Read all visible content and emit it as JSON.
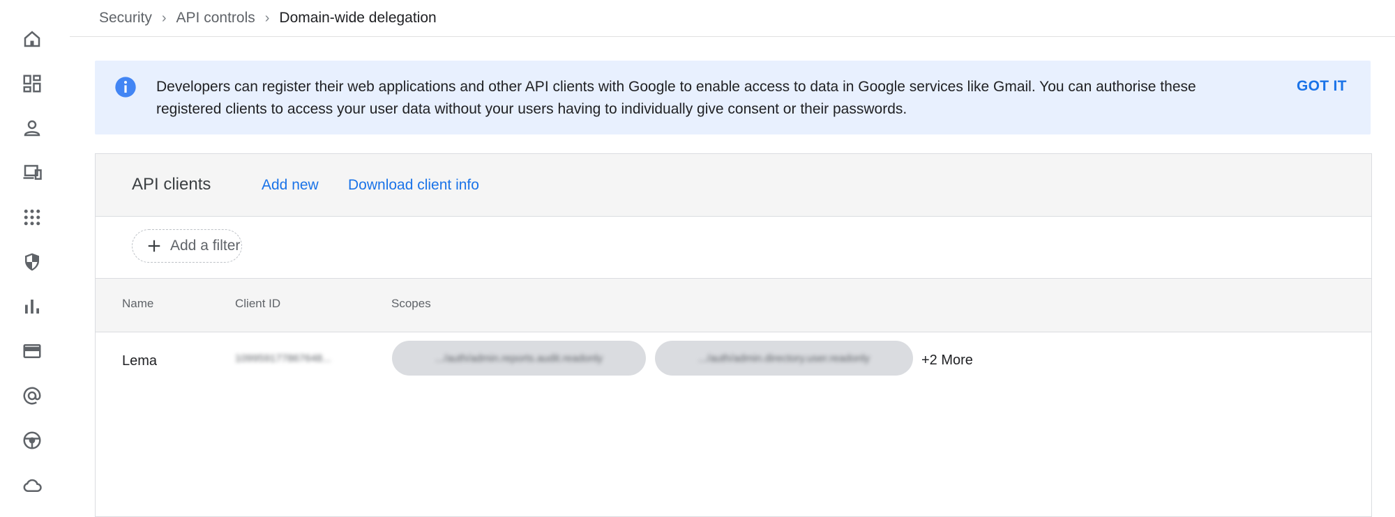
{
  "sidebar": {
    "items": [
      {
        "icon": "home-icon"
      },
      {
        "icon": "dashboard-icon"
      },
      {
        "icon": "user-icon"
      },
      {
        "icon": "devices-icon"
      },
      {
        "icon": "apps-grid-icon"
      },
      {
        "icon": "shield-icon"
      },
      {
        "icon": "reports-chart-icon"
      },
      {
        "icon": "billing-card-icon"
      },
      {
        "icon": "account-at-icon"
      },
      {
        "icon": "rules-wheel-icon"
      },
      {
        "icon": "cloud-icon"
      }
    ]
  },
  "breadcrumb": {
    "items": [
      "Security",
      "API controls"
    ],
    "current": "Domain-wide delegation"
  },
  "banner": {
    "line1": "Developers can register their web applications and other API clients with Google to enable access to data in Google services like Gmail. You can authorise these",
    "line2": "registered clients to access your user data without your users having to individually give consent or their passwords.",
    "action": "GOT IT"
  },
  "api_clients": {
    "title": "API clients",
    "add_new": "Add new",
    "download": "Download client info",
    "filter_label": "Add a filter",
    "columns": [
      "Name",
      "Client ID",
      "Scopes"
    ],
    "rows": [
      {
        "name": "Lema",
        "client_id": "109959177867648...",
        "scopes": [
          ".../auth/admin.reports.audit.readonly",
          ".../auth/admin.directory.user.readonly"
        ],
        "more": "+2 More"
      }
    ]
  },
  "colors": {
    "accent": "#1a73e8",
    "banner_bg": "#e8f0fe",
    "header_bg": "#f5f5f5",
    "icon_gray": "#5f6368"
  }
}
